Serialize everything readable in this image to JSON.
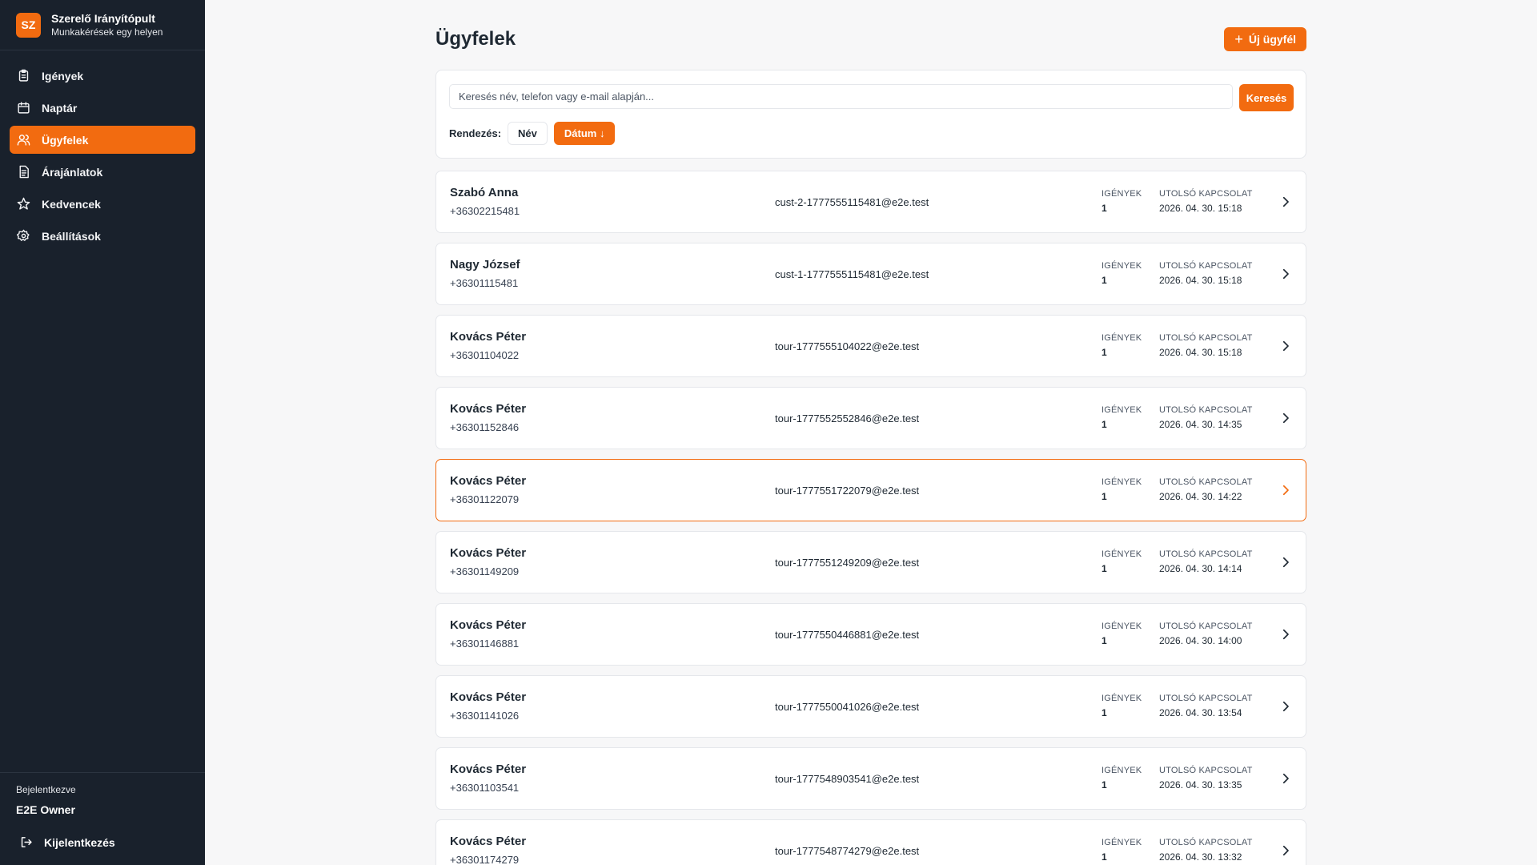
{
  "brand": {
    "logo": "SZ",
    "title": "Szerelő Irányítópult",
    "subtitle": "Munkakérések egy helyen"
  },
  "sidebar": {
    "items": [
      {
        "label": "Igények",
        "icon": "clipboard-icon",
        "active": false
      },
      {
        "label": "Naptár",
        "icon": "calendar-icon",
        "active": false
      },
      {
        "label": "Ügyfelek",
        "icon": "users-icon",
        "active": true
      },
      {
        "label": "Árajánlatok",
        "icon": "document-icon",
        "active": false
      },
      {
        "label": "Kedvencek",
        "icon": "star-icon",
        "active": false
      },
      {
        "label": "Beállítások",
        "icon": "gear-icon",
        "active": false
      }
    ],
    "footer": {
      "logged_in_label": "Bejelentkezve",
      "user_name": "E2E Owner",
      "logout_label": "Kijelentkezés"
    }
  },
  "page": {
    "title": "Ügyfelek",
    "new_button": "Új ügyfél"
  },
  "search": {
    "placeholder": "Keresés név, telefon vagy e-mail alapján...",
    "button": "Keresés",
    "sort_label": "Rendezés:",
    "sort_name": "Név",
    "sort_date": "Dátum ↓"
  },
  "columns": {
    "requests": "IGÉNYEK",
    "last_contact": "UTOLSÓ KAPCSOLAT"
  },
  "customers": [
    {
      "name": "Szabó Anna",
      "phone": "+36302215481",
      "email": "cust-2-1777555115481@e2e.test",
      "requests": "1",
      "last_contact": "2026. 04. 30. 15:18"
    },
    {
      "name": "Nagy József",
      "phone": "+36301115481",
      "email": "cust-1-1777555115481@e2e.test",
      "requests": "1",
      "last_contact": "2026. 04. 30. 15:18"
    },
    {
      "name": "Kovács Péter",
      "phone": "+36301104022",
      "email": "tour-1777555104022@e2e.test",
      "requests": "1",
      "last_contact": "2026. 04. 30. 15:18"
    },
    {
      "name": "Kovács Péter",
      "phone": "+36301152846",
      "email": "tour-1777552552846@e2e.test",
      "requests": "1",
      "last_contact": "2026. 04. 30. 14:35"
    },
    {
      "name": "Kovács Péter",
      "phone": "+36301122079",
      "email": "tour-1777551722079@e2e.test",
      "requests": "1",
      "last_contact": "2026. 04. 30. 14:22",
      "highlight": true
    },
    {
      "name": "Kovács Péter",
      "phone": "+36301149209",
      "email": "tour-1777551249209@e2e.test",
      "requests": "1",
      "last_contact": "2026. 04. 30. 14:14"
    },
    {
      "name": "Kovács Péter",
      "phone": "+36301146881",
      "email": "tour-1777550446881@e2e.test",
      "requests": "1",
      "last_contact": "2026. 04. 30. 14:00"
    },
    {
      "name": "Kovács Péter",
      "phone": "+36301141026",
      "email": "tour-1777550041026@e2e.test",
      "requests": "1",
      "last_contact": "2026. 04. 30. 13:54"
    },
    {
      "name": "Kovács Péter",
      "phone": "+36301103541",
      "email": "tour-1777548903541@e2e.test",
      "requests": "1",
      "last_contact": "2026. 04. 30. 13:35"
    },
    {
      "name": "Kovács Péter",
      "phone": "+36301174279",
      "email": "tour-1777548774279@e2e.test",
      "requests": "1",
      "last_contact": "2026. 04. 30. 13:32"
    }
  ],
  "colors": {
    "accent": "#f26b10",
    "sidebar_bg": "#19212c",
    "page_bg": "#f7f7f8"
  }
}
